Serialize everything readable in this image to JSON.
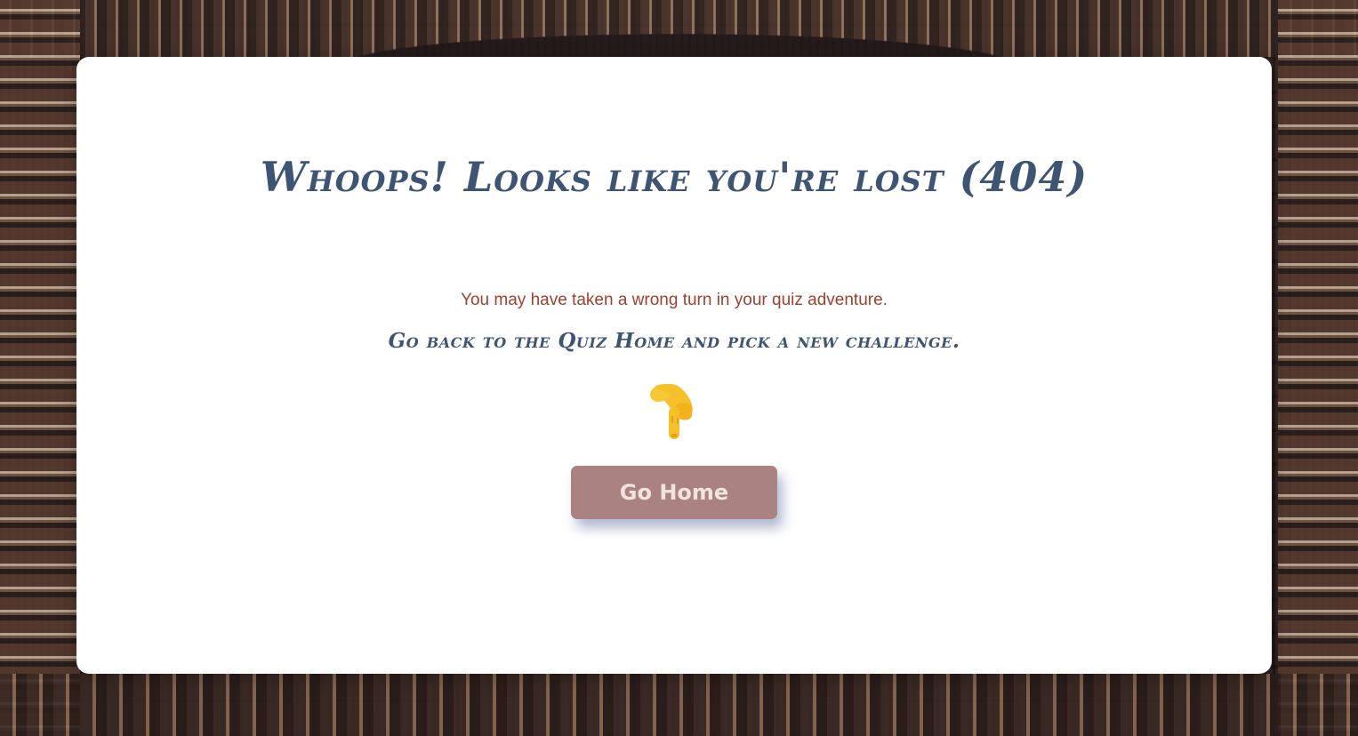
{
  "page": {
    "title": "Whoops! Looks like you're lost (404)",
    "message": "You may have taken a wrong turn in your quiz adventure.",
    "instruction": "Go back to the Quiz Home and pick a new challenge.",
    "pointer_icon": "pointing-down-hand-icon",
    "button_label": "Go Home"
  },
  "colors": {
    "title": "#3d5473",
    "message": "#a0402f",
    "button_bg": "#a98281",
    "button_text": "#f1e4df",
    "card_bg": "#ffffff"
  }
}
